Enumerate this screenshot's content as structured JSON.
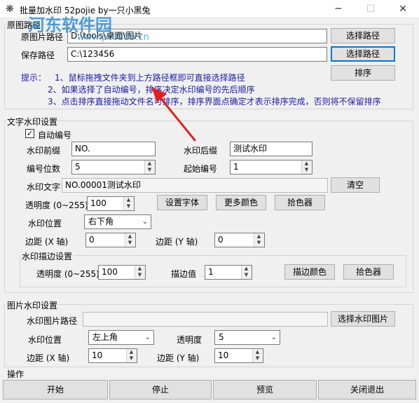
{
  "window": {
    "title": "批量加水印 52pojie by一只小黑兔",
    "app_icon": "❋",
    "minimize_icon": "─",
    "maximize_icon": "☐",
    "close_icon": "✕"
  },
  "path_group": {
    "title": "原图路径",
    "source_label": "原图片路径",
    "source_value": "D:\\tools\\桌面\\图片",
    "save_label": "保存路径",
    "save_value": "C:\\123456",
    "select_source_btn": "选择路径",
    "select_save_btn": "选择路径",
    "sort_btn": "排序",
    "tips_label": "提示：",
    "tips": [
      "1、鼠标拖拽文件夹到上方路径框即可直接选择路径",
      "2、如果选择了自动编号，排序决定水印编号的先后顺序",
      "3、点击排序直接拖动文件名可排序，排序界面点确定才表示排序完成，否则将不保留排序"
    ]
  },
  "text_group": {
    "title": "文字水印设置",
    "auto_number_label": "自动编号",
    "auto_number_checked": "✓",
    "prefix_label": "水印前缀",
    "prefix_value": "NO.",
    "suffix_label": "水印后缀",
    "suffix_value": "测试水印",
    "digits_label": "编号位数",
    "digits_value": "5",
    "start_label": "起始编号",
    "start_value": "1",
    "text_label": "水印文字",
    "text_value": "NO.00001测试水印",
    "clear_btn": "清空",
    "opacity_label": "透明度 (0~255)",
    "opacity_value": "100",
    "font_btn": "设置字体",
    "more_color_btn": "更多颜色",
    "picker_btn": "拾色器",
    "position_label": "水印位置",
    "position_value": "右下角",
    "margin_x_label": "边距 (X 轴)",
    "margin_x_value": "0",
    "margin_y_label": "边距 (Y 轴)",
    "margin_y_value": "0"
  },
  "stroke_group": {
    "title": "水印描边设置",
    "opacity_label": "透明度 (0~255)",
    "opacity_value": "100",
    "stroke_label": "描边值",
    "stroke_value": "1",
    "stroke_color_btn": "描边颜色",
    "picker_btn": "拾色器"
  },
  "image_group": {
    "title": "图片水印设置",
    "path_label": "水印图片路径",
    "path_value": "",
    "select_btn": "选择水印图片",
    "position_label": "水印位置",
    "position_value": "左上角",
    "opacity_label": "透明度",
    "opacity_value": "5",
    "margin_x_label": "边距 (X 轴)",
    "margin_x_value": "10",
    "margin_y_label": "边距 (Y 轴)",
    "margin_y_value": "10"
  },
  "operation_group": {
    "title": "操作",
    "start_btn": "开始",
    "stop_btn": "停止",
    "preview_btn": "预览",
    "close_btn": "关闭退出"
  },
  "overlay": {
    "watermark_text": "河东软件园",
    "watermark_url": "www.pc0359.cn"
  },
  "colors": {
    "tip_text": "#1a1aa8",
    "focus_border": "#0078d7",
    "arrow": "#e02020",
    "watermark": "#2f8fd0"
  }
}
